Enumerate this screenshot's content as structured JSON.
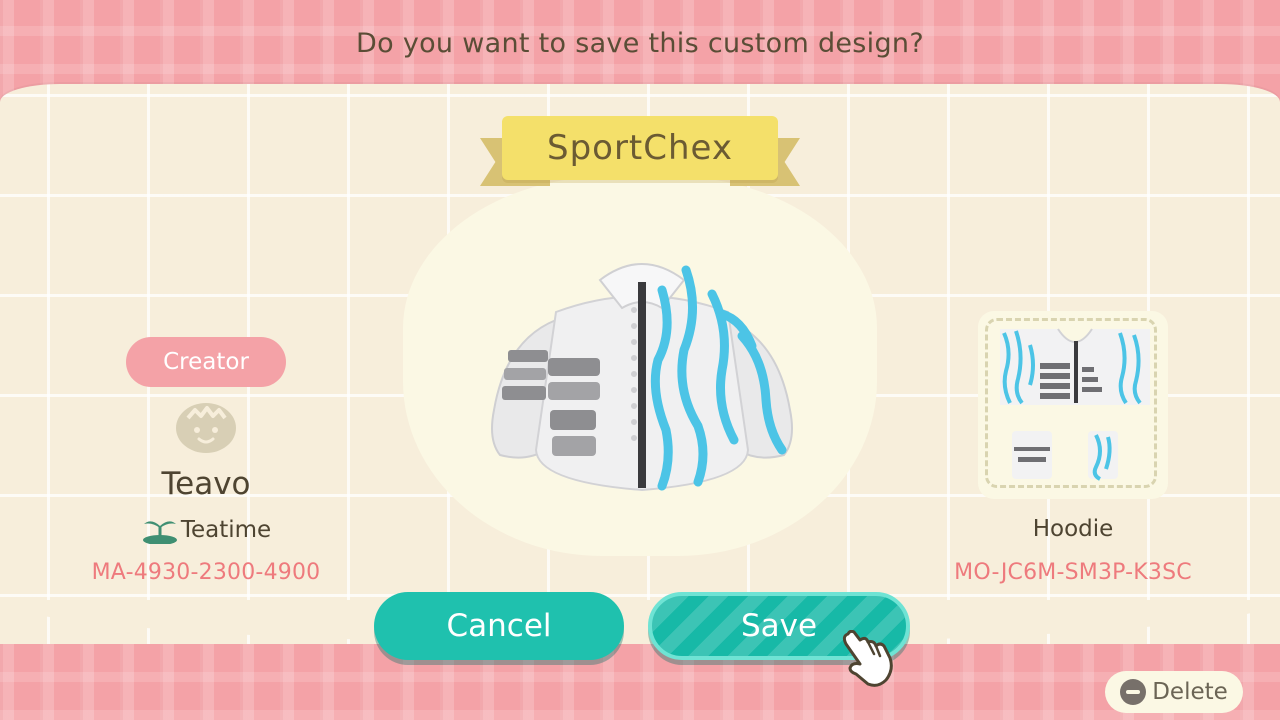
{
  "prompt": {
    "question": "Do you want to save this custom design?"
  },
  "design": {
    "title": "SportChex",
    "type": "Hoodie",
    "design_id": "MO-JC6M-SM3P-K3SC"
  },
  "creator": {
    "label": "Creator",
    "name": "Teavo",
    "island": "Teatime",
    "creator_id": "MA-4930-2300-4900"
  },
  "buttons": {
    "cancel": "Cancel",
    "save": "Save",
    "delete": "Delete"
  },
  "icons": {
    "creator_face": "villager-face-icon",
    "island": "palm-island-icon",
    "pointer": "pointing-hand-icon",
    "delete": "minus-circle-icon"
  },
  "colors": {
    "accent_teal": "#1fc1ae",
    "pink": "#f4a2a7",
    "id_text": "#ee7a7d",
    "ribbon": "#f4e06a",
    "jacket_blue": "#4cc4e6"
  }
}
